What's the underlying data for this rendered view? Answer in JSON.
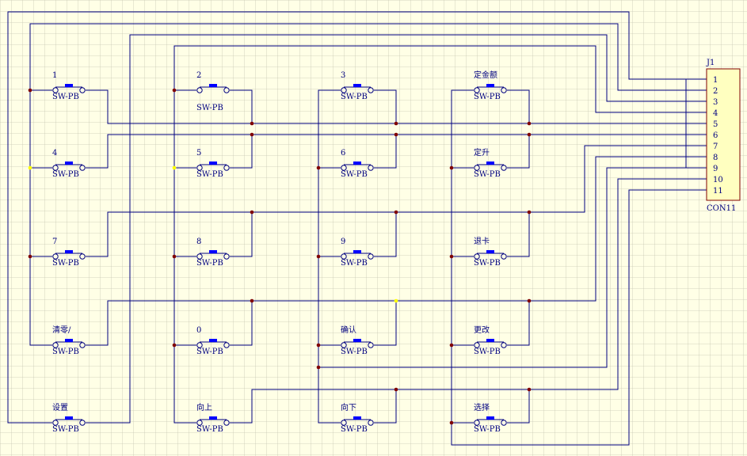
{
  "connector": {
    "designator": "J1",
    "part": "CON11",
    "pins": [
      "1",
      "2",
      "3",
      "4",
      "5",
      "6",
      "7",
      "8",
      "9",
      "10",
      "11"
    ]
  },
  "switches": [
    {
      "id": "sw-1",
      "label": "1",
      "part": "SW-PB"
    },
    {
      "id": "sw-2",
      "label": "2",
      "part": "SW-PB"
    },
    {
      "id": "sw-3",
      "label": "3",
      "part": "SW-PB"
    },
    {
      "id": "sw-dingjine",
      "label": "定金额",
      "part": "SW-PB"
    },
    {
      "id": "sw-4",
      "label": "4",
      "part": "SW-PB"
    },
    {
      "id": "sw-5",
      "label": "5",
      "part": "SW-PB"
    },
    {
      "id": "sw-6",
      "label": "6",
      "part": "SW-PB"
    },
    {
      "id": "sw-dingsheng",
      "label": "定升",
      "part": "SW-PB"
    },
    {
      "id": "sw-7",
      "label": "7",
      "part": "SW-PB"
    },
    {
      "id": "sw-8",
      "label": "8",
      "part": "SW-PB"
    },
    {
      "id": "sw-9",
      "label": "9",
      "part": "SW-PB"
    },
    {
      "id": "sw-tuika",
      "label": "退卡",
      "part": "SW-PB"
    },
    {
      "id": "sw-qingling",
      "label": "清零/",
      "part": "SW-PB"
    },
    {
      "id": "sw-0",
      "label": "0",
      "part": "SW-PB"
    },
    {
      "id": "sw-queren",
      "label": "确认",
      "part": "SW-PB"
    },
    {
      "id": "sw-genggai",
      "label": "更改",
      "part": "SW-PB"
    },
    {
      "id": "sw-shezhi",
      "label": "设置",
      "part": "SW-PB"
    },
    {
      "id": "sw-xiangshang",
      "label": "向上",
      "part": "SW-PB"
    },
    {
      "id": "sw-xiangxia",
      "label": "向下",
      "part": "SW-PB"
    },
    {
      "id": "sw-xuanze",
      "label": "选择",
      "part": "SW-PB"
    }
  ],
  "colors": {
    "background": "#ffffe6",
    "grid": "#c8c8b4",
    "wire": "#000080",
    "junction": "#800000",
    "switch_bar": "#0000ff",
    "connector_fill": "#ffffc0",
    "highlight_junction": "#ffff00"
  }
}
